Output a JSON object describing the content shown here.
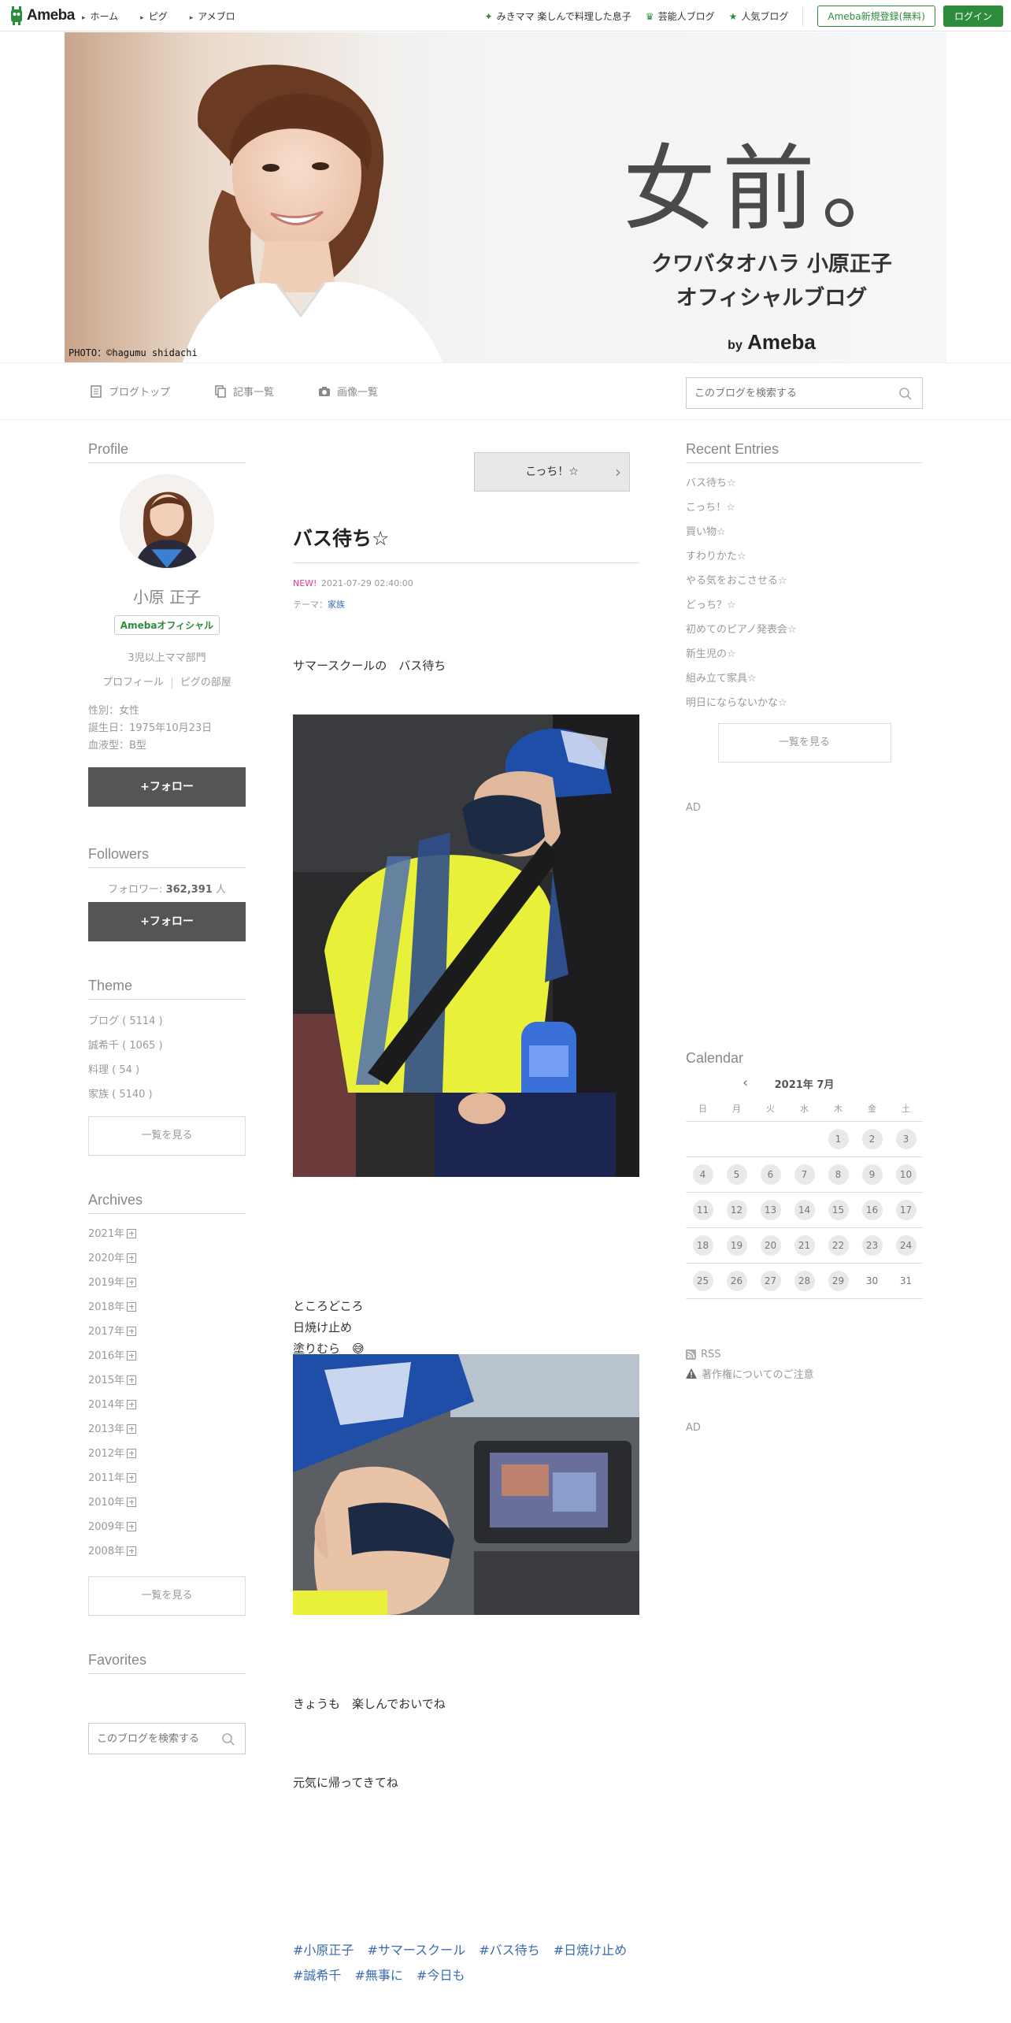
{
  "topbar": {
    "logo": "Ameba",
    "nav": [
      "ホーム",
      "ピグ",
      "アメブロ"
    ],
    "links": [
      "みきママ 楽しんで料理した息子",
      "芸能人ブログ",
      "人気ブログ"
    ],
    "register": "Ameba新規登録(無料)",
    "login": "ログイン"
  },
  "banner": {
    "title": "女前。",
    "subtitle1": "クワバタオハラ 小原正子",
    "subtitle2": "オフィシャルブログ",
    "by": "by",
    "brand": "Ameba",
    "credit": "PHOTO：©hagumu shidachi"
  },
  "blognav": {
    "items": [
      "ブログトップ",
      "記事一覧",
      "画像一覧"
    ],
    "search_placeholder": "このブログを検索する"
  },
  "profile": {
    "heading": "Profile",
    "name": "小原 正子",
    "badge": "Amebaオフィシャル",
    "category": "3児以上ママ部門",
    "link_profile": "プロフィール",
    "link_room": "ピグの部屋",
    "gender": "性別：女性",
    "birthday": "誕生日：1975年10月23日",
    "blood": "血液型：B型",
    "follow": "+フォロー"
  },
  "followers": {
    "heading": "Followers",
    "label": "フォロワー:",
    "count": "362,391",
    "unit": "人",
    "follow": "+フォロー"
  },
  "theme": {
    "heading": "Theme",
    "items": [
      "ブログ ( 5114 )",
      "誠希千 ( 1065 )",
      "料理 ( 54 )",
      "家族 ( 5140 )"
    ],
    "more": "一覧を見る"
  },
  "archives": {
    "heading": "Archives",
    "years": [
      "2021年",
      "2020年",
      "2019年",
      "2018年",
      "2017年",
      "2016年",
      "2015年",
      "2014年",
      "2013年",
      "2012年",
      "2011年",
      "2010年",
      "2009年",
      "2008年"
    ],
    "more": "一覧を見る"
  },
  "favorites": {
    "heading": "Favorites",
    "search_placeholder": "このブログを検索する"
  },
  "entry": {
    "next": "こっち！☆",
    "title": "バス待ち☆",
    "new": "NEW!",
    "date": "2021-07-29 02:40:00",
    "theme_label": "テーマ：",
    "theme": "家族",
    "p1": "サマースクールの　バス待ち",
    "p2a": "ところどころ",
    "p2b": "日焼け止め",
    "p2c": "塗りむら　😅",
    "p3": "きょうも　楽しんでおいでね",
    "p4": "元気に帰ってきてね",
    "hashtags": [
      "#小原正子",
      "#サマースクール",
      "#バス待ち",
      "#日焼け止め",
      "#誠希千",
      "#無事に",
      "#今日も"
    ]
  },
  "recent": {
    "heading": "Recent Entries",
    "items": [
      "バス待ち☆",
      "こっち！☆",
      "買い物☆",
      "すわりかた☆",
      "やる気をおこさせる☆",
      "どっち？☆",
      "初めてのピアノ発表会☆",
      "新生児の☆",
      "組み立て家具☆",
      "明日にならないかな☆"
    ],
    "more": "一覧を見る",
    "ad": "AD"
  },
  "calendar": {
    "heading": "Calendar",
    "month": "2021年 7月",
    "dow": [
      "日",
      "月",
      "火",
      "水",
      "木",
      "金",
      "土"
    ],
    "days": [
      "",
      "",
      "",
      "",
      "1",
      "2",
      "3",
      "4",
      "5",
      "6",
      "7",
      "8",
      "9",
      "10",
      "11",
      "12",
      "13",
      "14",
      "15",
      "16",
      "17",
      "18",
      "19",
      "20",
      "21",
      "22",
      "23",
      "24",
      "25",
      "26",
      "27",
      "28",
      "29",
      "30",
      "31"
    ],
    "last_past_day": 29
  },
  "footer_links": {
    "rss": "RSS",
    "copyright": "著作権についてのご注意",
    "ad": "AD"
  },
  "colors": {
    "accent": "#2d8c3c",
    "link": "#3a6bb0",
    "new": "#e6398f"
  }
}
